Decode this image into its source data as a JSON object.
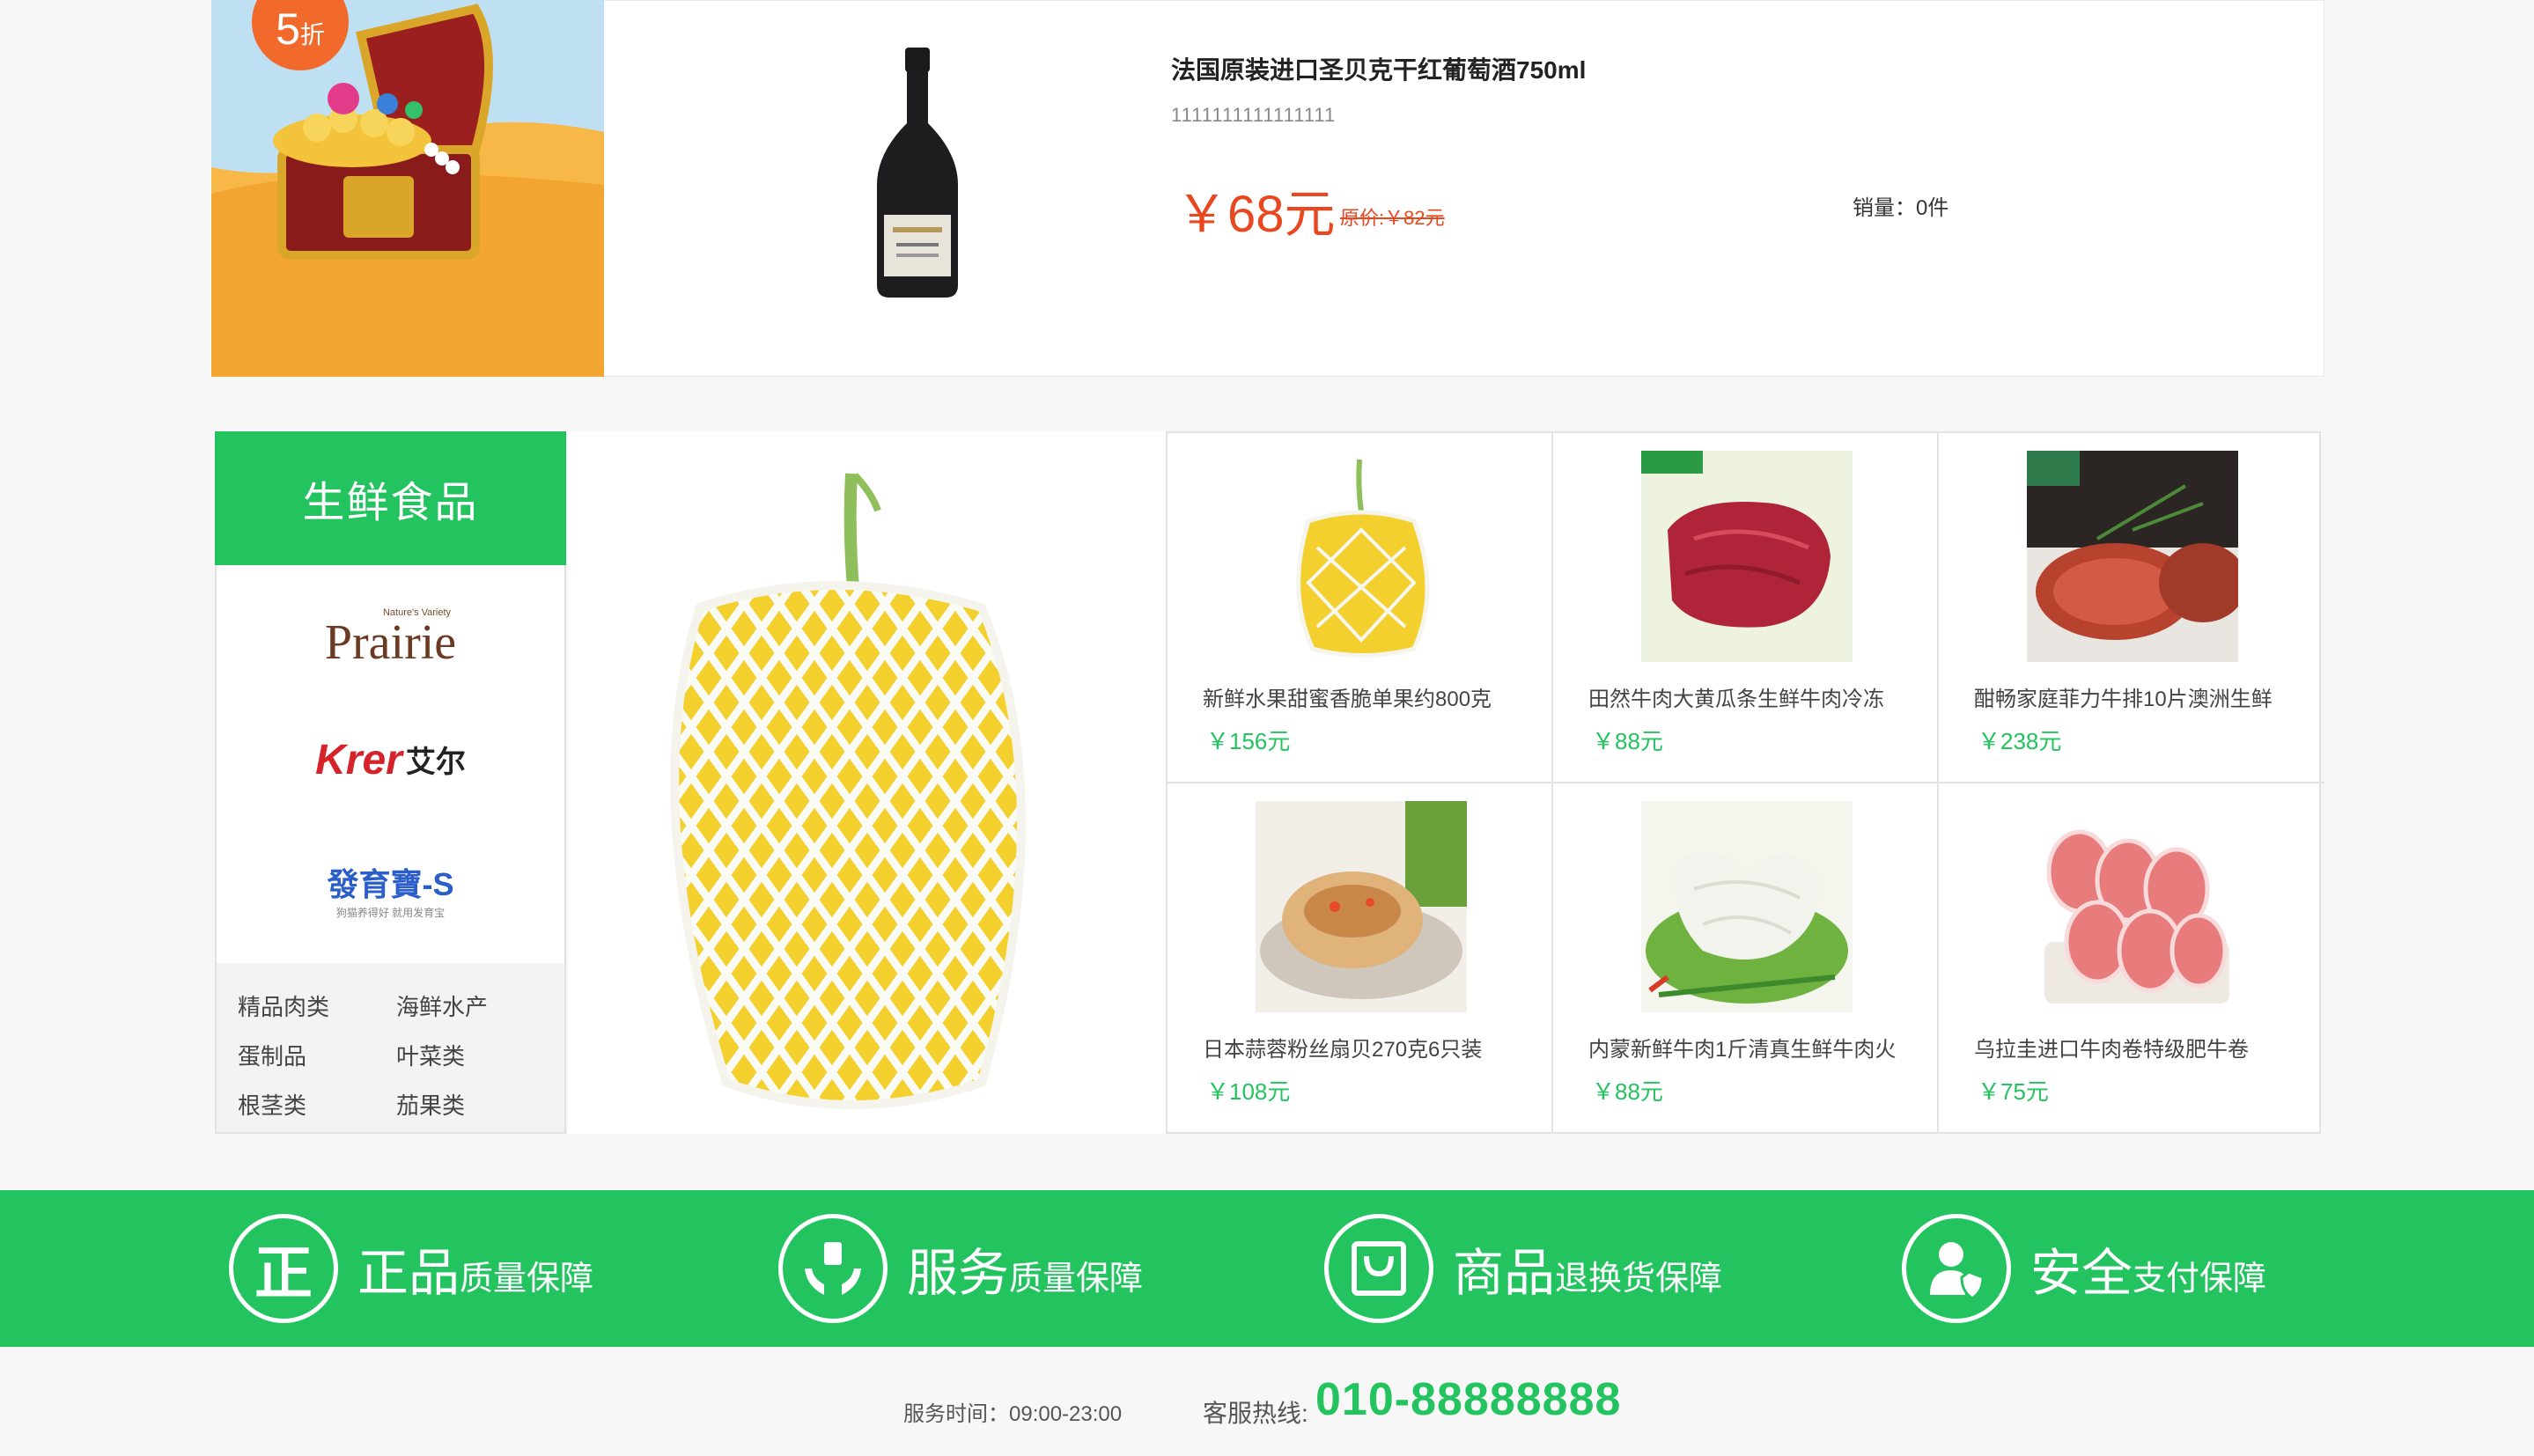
{
  "promo": {
    "badge_number": "5",
    "badge_unit": "折",
    "product": {
      "title": "法国原装进口圣贝克干红葡萄酒750ml",
      "subtitle": "1111111111111111",
      "price": "￥68元",
      "original_price": "原价:￥82元",
      "sales": "销量：0件"
    }
  },
  "fresh": {
    "category_title": "生鲜食品",
    "brands": [
      {
        "name": "Prairie",
        "tagline": "Nature's Variety"
      },
      {
        "name": "Krer",
        "cn": "艾尔"
      },
      {
        "name": "發育寶-S",
        "tagline": "狗猫养得好 就用发育宝"
      }
    ],
    "subcategories": [
      "精品肉类",
      "海鲜水产",
      "蛋制品",
      "叶菜类",
      "根茎类",
      "茄果类"
    ],
    "products": [
      {
        "name": "新鲜水果甜蜜香脆单果约800克",
        "price": "￥156元"
      },
      {
        "name": "田然牛肉大黄瓜条生鲜牛肉冷冻",
        "price": "￥88元"
      },
      {
        "name": "酣畅家庭菲力牛排10片澳洲生鲜",
        "price": "￥238元"
      },
      {
        "name": "日本蒜蓉粉丝扇贝270克6只装",
        "price": "￥108元"
      },
      {
        "name": "内蒙新鲜牛肉1斤清真生鲜牛肉火",
        "price": "￥88元"
      },
      {
        "name": "乌拉圭进口牛肉卷特级肥牛卷",
        "price": "￥75元"
      }
    ]
  },
  "guarantees": [
    {
      "big": "正品",
      "small": "质量保障",
      "icon": "genuine-icon",
      "glyph": "正"
    },
    {
      "big": "服务",
      "small": "质量保障",
      "icon": "hands-service-icon"
    },
    {
      "big": "商品",
      "small": "退换货保障",
      "icon": "shopping-bag-icon"
    },
    {
      "big": "安全",
      "small": "支付保障",
      "icon": "user-shield-icon"
    }
  ],
  "footer": {
    "hours": "服务时间：09:00-23:00",
    "hotline_label": "客服热线:",
    "hotline": "010-88888888"
  },
  "colors": {
    "green": "#23c460",
    "price_red": "#e8471f",
    "banner_orange": "#f5b342"
  }
}
